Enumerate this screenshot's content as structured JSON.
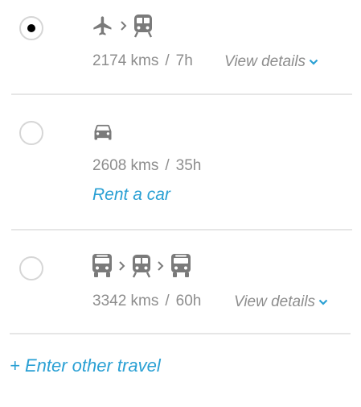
{
  "options": [
    {
      "selected": true,
      "modes": [
        "plane-icon",
        "train-icon"
      ],
      "distance": "2174 kms",
      "separator": "/",
      "duration": "7h",
      "details_label": "View details"
    },
    {
      "selected": false,
      "modes": [
        "car-icon"
      ],
      "distance": "2608 kms",
      "separator": "/",
      "duration": "35h",
      "action_label": "Rent a car"
    },
    {
      "selected": false,
      "modes": [
        "bus-icon",
        "train-icon",
        "bus-icon"
      ],
      "distance": "3342 kms",
      "separator": "/",
      "duration": "60h",
      "details_label": "View details"
    }
  ],
  "other_travel_label": "+ Enter other travel",
  "colors": {
    "link": "#2aa0d4",
    "muted_text": "#8d8d8d",
    "icon": "#7a7a7a",
    "divider": "#e6e6e6",
    "radio_border": "#d6d6d6"
  }
}
